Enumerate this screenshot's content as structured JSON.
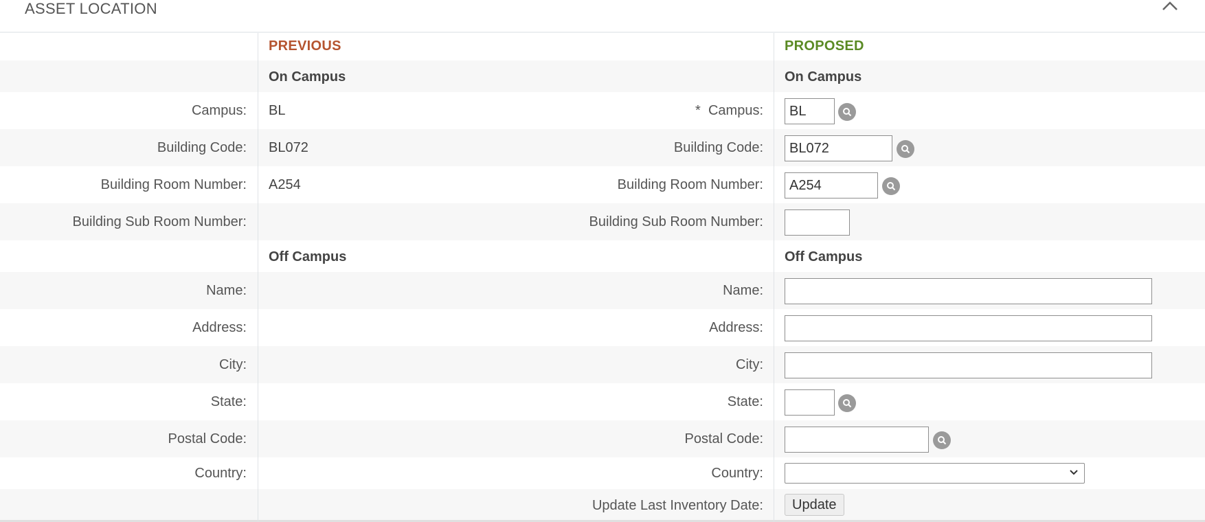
{
  "panel": {
    "title": "ASSET LOCATION"
  },
  "columns": {
    "previous": "PREVIOUS",
    "proposed": "PROPOSED",
    "previous_color": "#b5542f",
    "proposed_color": "#5a8a24"
  },
  "sections": {
    "on_campus": "On Campus",
    "off_campus": "Off Campus"
  },
  "labels": {
    "campus": "Campus:",
    "building_code": "Building Code:",
    "building_room_number": "Building Room Number:",
    "building_sub_room_number": "Building Sub Room Number:",
    "name": "Name:",
    "address": "Address:",
    "city": "City:",
    "state": "State:",
    "postal_code": "Postal Code:",
    "country": "Country:",
    "update_last_inventory_date": "Update Last Inventory Date:",
    "required_marker": "*"
  },
  "previous": {
    "campus": "BL",
    "building_code": "BL072",
    "building_room_number": "A254"
  },
  "proposed": {
    "campus": "BL",
    "building_code": "BL072",
    "building_room_number": "A254",
    "building_sub_room_number": "",
    "name": "",
    "address": "",
    "city": "",
    "state": "",
    "postal_code": "",
    "country": ""
  },
  "buttons": {
    "update": "Update"
  },
  "icons": {
    "lookup": "search-icon",
    "collapse": "chevron-up-icon",
    "dropdown": "chevron-down-icon"
  }
}
